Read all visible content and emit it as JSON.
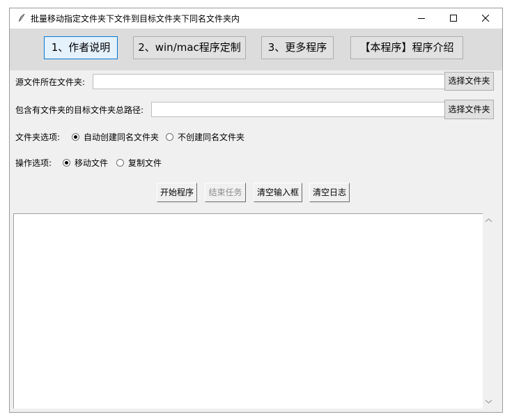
{
  "window": {
    "title": "批量移动指定文件夹下文件到目标文件夹下同名文件夹内",
    "icon": "feather-icon",
    "controls": [
      "minimize-icon",
      "maximize-icon",
      "close-icon"
    ]
  },
  "top_buttons": [
    {
      "label": "1、作者说明",
      "active": true
    },
    {
      "label": "2、win/mac程序定制",
      "active": false
    },
    {
      "label": "3、更多程序",
      "active": false
    },
    {
      "label": "【本程序】程序介绍",
      "active": false
    }
  ],
  "source": {
    "label": "源文件所在文件夹:",
    "value": "",
    "button": "选择文件夹"
  },
  "target": {
    "label": "包含有文件夹的目标文件夹总路径:",
    "value": "",
    "button": "选择文件夹"
  },
  "folder_options": {
    "label": "文件夹选项:",
    "options": [
      "自动创建同名文件夹",
      "不创建同名文件夹"
    ],
    "selected": "自动创建同名文件夹"
  },
  "operation_options": {
    "label": "操作选项:",
    "options": [
      "移动文件",
      "复制文件"
    ],
    "selected": "移动文件"
  },
  "actions": {
    "start": "开始程序",
    "stop": "结束任务",
    "clear_inputs": "清空输入框",
    "clear_log": "清空日志"
  },
  "log": {
    "content": ""
  },
  "colors": {
    "window_bg": "#f0f0f0",
    "top_bar_bg": "#dcdcdc",
    "active_border": "#0078d7",
    "disabled_text": "#8d8d8d"
  }
}
